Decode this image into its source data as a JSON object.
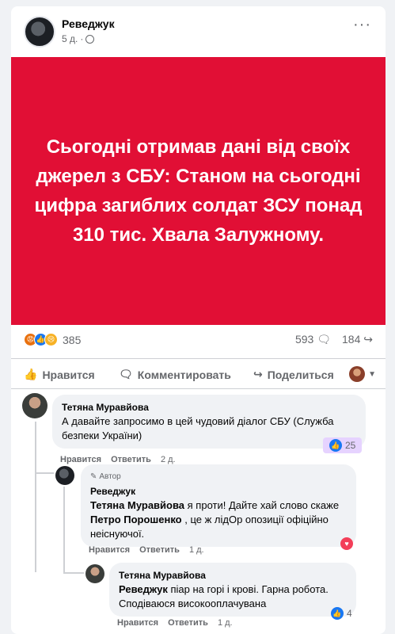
{
  "post": {
    "author": "Реведжук",
    "time": "5 д.",
    "text": "Сьогодні отримав дані від своїх джерел з СБУ: Станом на сьогодні цифра загиблих солдат ЗСУ понад 310 тис. Хвала Залужному.",
    "reactions_count": "385",
    "comments_count": "593",
    "shares_count": "184"
  },
  "actions": {
    "like": "Нравится",
    "comment": "Комментировать",
    "share": "Поделиться"
  },
  "comments": [
    {
      "name": "Тетяна Муравйова",
      "text": "А давайте запросимо в цей чудовий діалог СБУ (Служба безпеки України)",
      "like": "Нравится",
      "reply": "Ответить",
      "time": "2 д.",
      "reactions": "25"
    },
    {
      "badge": "Автор",
      "name": "Реведжук",
      "mention": "Тетяна Муравйова",
      "text_a": " я проти! Дайте хай слово скаже ",
      "mention2": "Петро Порошенко",
      "text_b": " , це ж лідОр опозиції офіційно неіснуючої.",
      "like": "Нравится",
      "reply": "Ответить",
      "time": "1 д."
    },
    {
      "name": "Тетяна Муравйова",
      "mention": "Реведжук",
      "text": " піар на горі і крові. Гарна робота. Сподіваюся високооплачувана",
      "like": "Нравится",
      "reply": "Ответить",
      "time": "1 д.",
      "reactions": "4"
    }
  ],
  "colors": {
    "poster_bg": "#e10f35",
    "like_blue": "#1877f2",
    "love_red": "#f33e58"
  }
}
